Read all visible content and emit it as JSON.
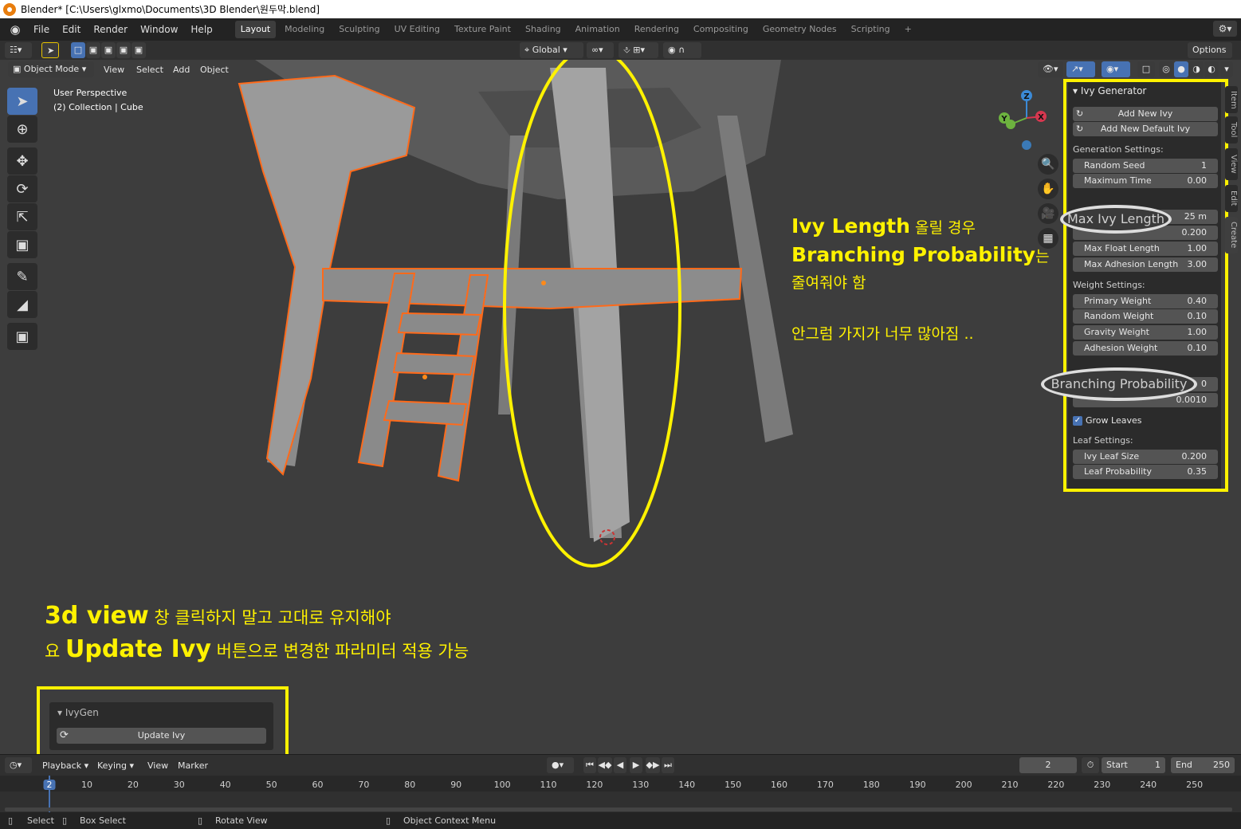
{
  "window": {
    "title": "Blender* [C:\\Users\\glxmo\\Documents\\3D Blender\\원두막.blend]"
  },
  "menu": [
    "File",
    "Edit",
    "Render",
    "Window",
    "Help"
  ],
  "workspaces": [
    "Layout",
    "Modeling",
    "Sculpting",
    "UV Editing",
    "Texture Paint",
    "Shading",
    "Animation",
    "Rendering",
    "Compositing",
    "Geometry Nodes",
    "Scripting"
  ],
  "active_workspace": "Layout",
  "header": {
    "transform_orientation": "Global",
    "options_label": "Options",
    "mode": "Object Mode",
    "view_menu": [
      "View",
      "Select",
      "Add",
      "Object"
    ]
  },
  "viewport": {
    "perspective_label": "User Perspective",
    "collection_label": "(2) Collection | Cube",
    "gizmo": {
      "z": "Z",
      "y": "Y",
      "x": "X"
    }
  },
  "npanel": {
    "title": "Ivy Generator",
    "add_new_ivy": "Add New Ivy",
    "add_new_default_ivy": "Add New Default Ivy",
    "generation_settings_label": "Generation Settings:",
    "generation": [
      {
        "label": "Random Seed",
        "value": "1"
      },
      {
        "label": "Maximum Time",
        "value": "0.00"
      }
    ],
    "size_rows": [
      {
        "label": "Max Ivy Length",
        "value": "25 m"
      },
      {
        "label": "",
        "value": "0.200"
      },
      {
        "label": "Max Float Length",
        "value": "1.00"
      },
      {
        "label": "Max Adhesion Length",
        "value": "3.00"
      }
    ],
    "weight_settings_label": "Weight Settings:",
    "weights": [
      {
        "label": "Primary Weight",
        "value": "0.40"
      },
      {
        "label": "Random Weight",
        "value": "0.10"
      },
      {
        "label": "Gravity Weight",
        "value": "1.00"
      },
      {
        "label": "Adhesion Weight",
        "value": "0.10"
      }
    ],
    "branching_label": "Branching Probability",
    "branching_value": "0",
    "branching_second_value": "0.0010",
    "grow_leaves_label": "Grow Leaves",
    "grow_leaves_checked": true,
    "leaf_settings_label": "Leaf Settings:",
    "leaf": [
      {
        "label": "Ivy Leaf Size",
        "value": "0.200"
      },
      {
        "label": "Leaf Probability",
        "value": "0.35"
      }
    ],
    "side_tabs": [
      "Item",
      "Tool",
      "View",
      "Edit",
      "Create"
    ]
  },
  "ivygen_panel": {
    "title": "IvyGen",
    "update_button": "Update Ivy"
  },
  "annotations": {
    "right_line1_en": "Ivy Length",
    "right_line1_ko": " 올릴 경우",
    "right_line2_en": "Branching Probability",
    "right_line2_ko": "는",
    "right_line3": "줄여줘야 함",
    "right_line4": "안그럼 가지가 너무 많아짐 ..",
    "bottom_line1_en": "3d view",
    "bottom_line1_ko": " 창 클릭하지 말고 고대로 유지해야",
    "bottom_line2_pre": "요 ",
    "bottom_line2_en": "Update Ivy",
    "bottom_line2_ko": " 버튼으로 변경한 파라미터 적용 가능"
  },
  "timeline": {
    "menu": [
      "Playback",
      "Keying",
      "View",
      "Marker"
    ],
    "current_frame": "2",
    "start_label": "Start",
    "start_value": "1",
    "end_label": "End",
    "end_value": "250",
    "ticks": [
      "2",
      "10",
      "20",
      "30",
      "40",
      "50",
      "60",
      "70",
      "80",
      "90",
      "100",
      "110",
      "120",
      "130",
      "140",
      "150",
      "160",
      "170",
      "180",
      "190",
      "200",
      "210",
      "220",
      "230",
      "240",
      "250"
    ]
  },
  "statusbar": {
    "select": "Select",
    "box_select": "Box Select",
    "rotate_view": "Rotate View",
    "context_menu": "Object Context Menu"
  },
  "colors": {
    "highlight_yellow": "#fff200",
    "selection_orange": "#ff6a1a",
    "accent_blue": "#4772b3"
  }
}
